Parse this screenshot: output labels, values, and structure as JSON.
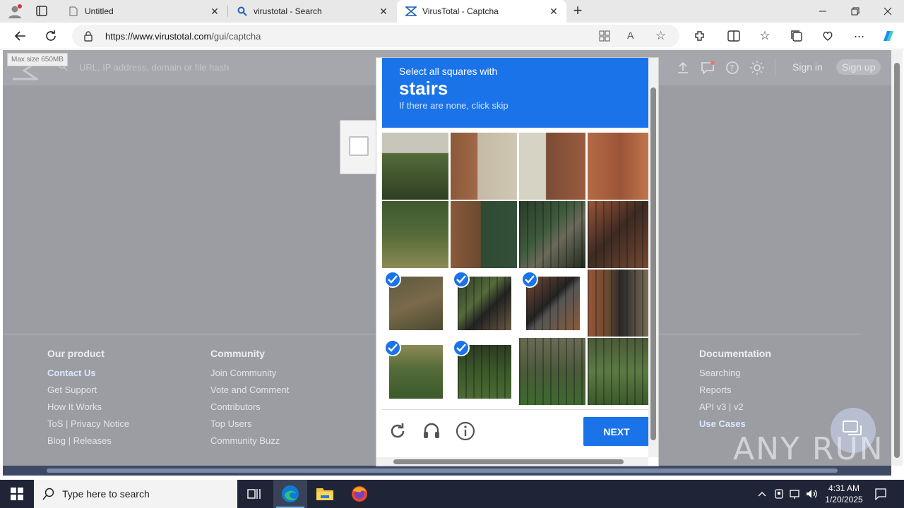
{
  "browser": {
    "tabs": [
      {
        "title": "Untitled",
        "close": "✕"
      },
      {
        "title": "virustotal - Search",
        "close": "✕"
      },
      {
        "title": "VirusTotal - Captcha",
        "close": "✕"
      }
    ],
    "new_tab_label": "+",
    "url_host": "https://www.virustotal.com",
    "url_path": "/gui/captcha"
  },
  "virustotal": {
    "tooltip": "Max size 650MB",
    "search_placeholder": "URL, IP address, domain or file hash",
    "sign_in": "Sign in",
    "sign_up": "Sign up"
  },
  "captcha": {
    "prompt": "Select all squares with",
    "target": "stairs",
    "hint": "If there are none, click skip",
    "next_label": "NEXT",
    "selected_tiles": [
      8,
      9,
      10,
      12,
      13
    ]
  },
  "footer": {
    "columns": [
      {
        "heading": "Our product",
        "links": [
          "Contact Us",
          "Get Support",
          "How It Works",
          "ToS | Privacy Notice",
          "Blog | Releases"
        ]
      },
      {
        "heading": "Community",
        "links": [
          "Join Community",
          "Vote and Comment",
          "Contributors",
          "Top Users",
          "Community Buzz"
        ]
      },
      {
        "heading": "Documentation",
        "links": [
          "Searching",
          "Reports",
          "API v3 | v2",
          "Use Cases"
        ]
      }
    ]
  },
  "watermark": "ANY RUN",
  "taskbar": {
    "search_placeholder": "Type here to search",
    "time": "4:31 AM",
    "date": "1/20/2025"
  }
}
